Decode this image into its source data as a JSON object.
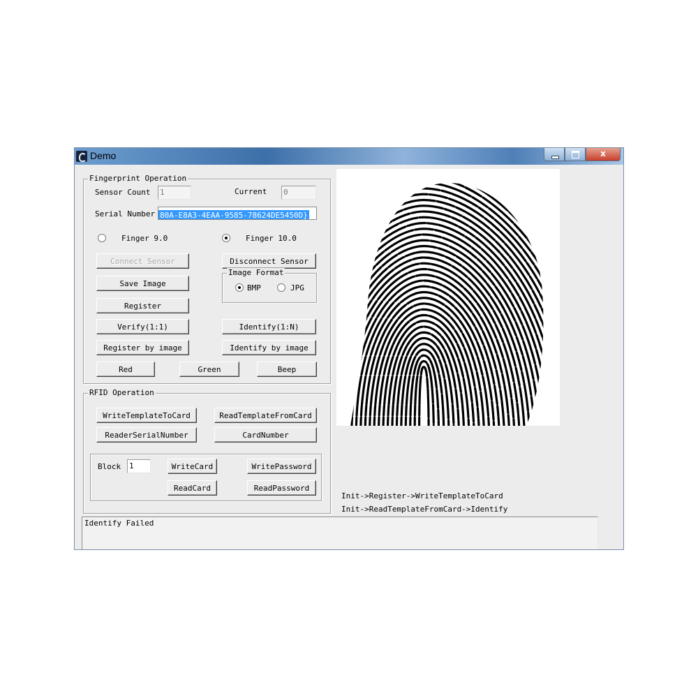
{
  "window": {
    "title": "Demo",
    "close_glyph": "x"
  },
  "fingerprint": {
    "group_title": "Fingerprint Operation",
    "sensor_count_label": "Sensor Count",
    "sensor_count_value": "1",
    "current_label": "Current",
    "current_value": "0",
    "serial_label": "Serial Number",
    "serial_value": "80A-E8A3-4EAA-9585-78624DE5450D}",
    "finger_90_label": "Finger 9.0",
    "finger_100_label": "Finger 10.0",
    "selected_finger": "Finger 10.0",
    "connect_label": "Connect Sensor",
    "disconnect_label": "Disconnect Sensor",
    "image_format_title": "Image Format",
    "bmp_label": "BMP",
    "jpg_label": "JPG",
    "selected_format": "BMP",
    "save_image_label": "Save Image",
    "register_label": "Register",
    "verify_label": "Verify(1:1)",
    "identify_label": "Identify(1:N)",
    "register_image_label": "Register by image",
    "identify_image_label": "Identify by image",
    "red_label": "Red",
    "green_label": "Green",
    "beep_label": "Beep"
  },
  "rfid": {
    "group_title": "RFID Operation",
    "write_template_label": "WriteTemplateToCard",
    "read_template_label": "ReadTemplateFromCard",
    "reader_serial_label": "ReaderSerialNumber",
    "card_number_label": "CardNumber",
    "block_label": "Block",
    "block_value": "1",
    "write_card_label": "WriteCard",
    "write_password_label": "WritePassword",
    "read_card_label": "ReadCard",
    "read_password_label": "ReadPassword"
  },
  "hints": {
    "line1": "Init->Register->WriteTemplateToCard",
    "line2": "Init->ReadTemplateFromCard->Identify"
  },
  "status_text": "Identify Failed",
  "colors": {
    "selection": "#3399ff",
    "close_button": "#c7412c",
    "dialog_bg": "#ececec"
  }
}
